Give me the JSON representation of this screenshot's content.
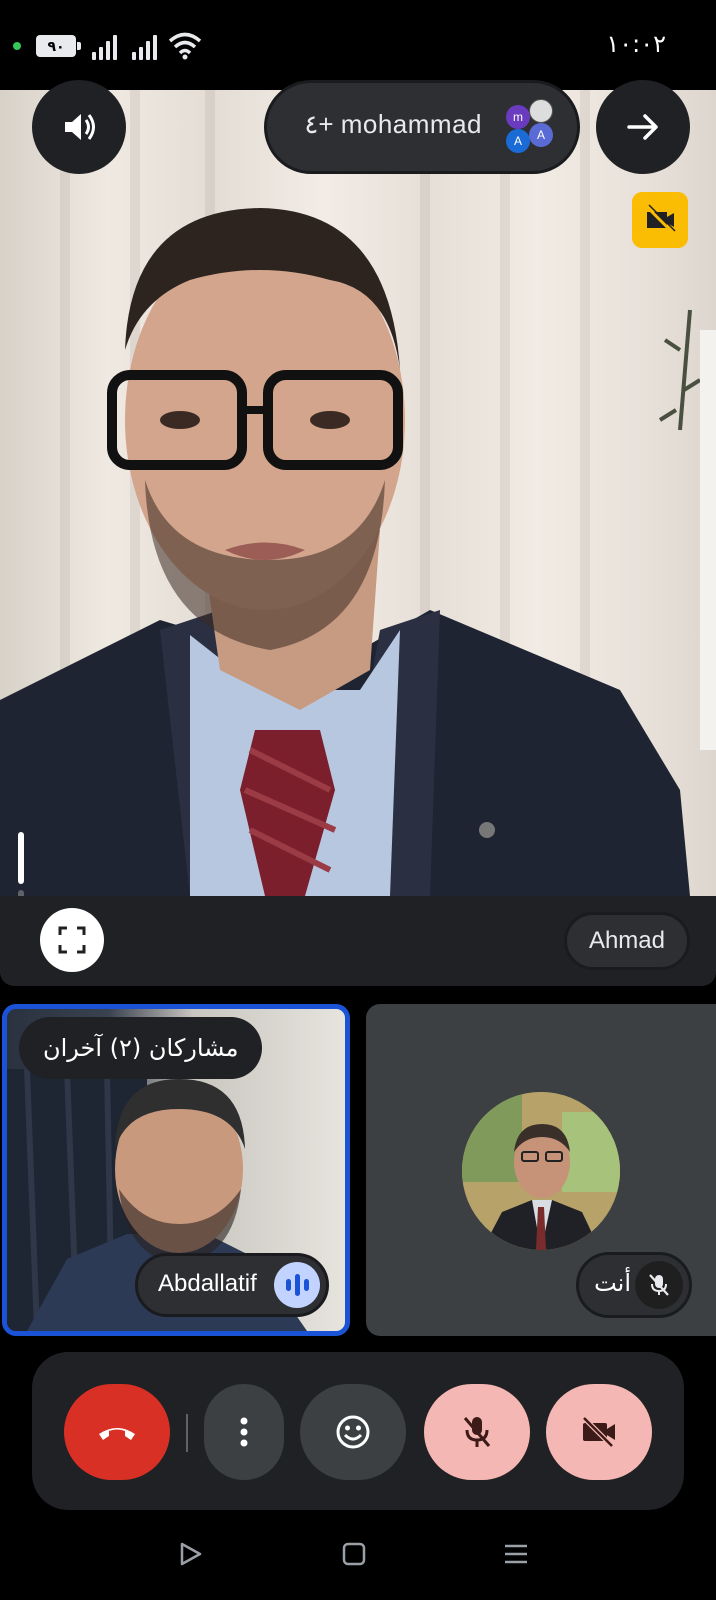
{
  "status_bar": {
    "battery": "٩٠",
    "time": "١٠:٠٢"
  },
  "call": {
    "participants_pill": "٤+ mohammad",
    "participant_avatars": [
      "m",
      "A",
      "A"
    ],
    "main_speaker_name": "Ahmad",
    "others_label": "مشاركان (٢) آخران",
    "active_speaker_name": "Abdallatif",
    "self_label": "أنت"
  },
  "icons": {
    "speaker": "speaker-volume-icon",
    "switch": "arrow-right-icon",
    "camera_off_badge": "video-off-icon",
    "fullscreen": "fullscreen-icon",
    "speaking": "audio-level-icon",
    "mic_off": "mic-off-icon",
    "end_call": "call-end-icon",
    "more": "more-vert-icon",
    "reactions": "emoji-icon",
    "camera_off": "videocam-off-icon",
    "back": "nav-back-icon",
    "home": "nav-home-icon",
    "recents": "nav-recents-icon"
  },
  "colors": {
    "end_call": "#d93025",
    "muted_button": "#f5b7b3",
    "active_border": "#1a53d6",
    "warning_badge": "#fbbc04"
  }
}
